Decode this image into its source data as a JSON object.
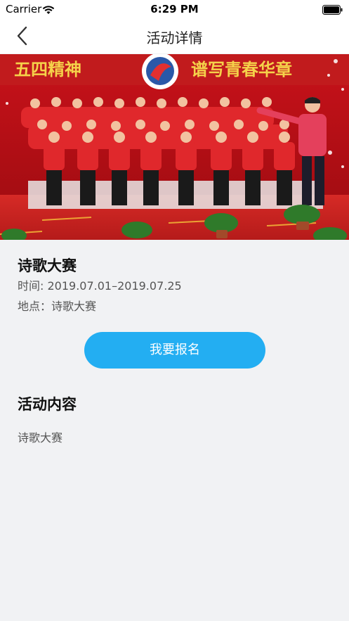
{
  "status_bar": {
    "carrier": "Carrier",
    "time": "6:29 PM"
  },
  "nav": {
    "title": "活动详情",
    "back_icon": "chevron-left-icon"
  },
  "banner": {
    "image": "choir-performance-photo",
    "banner_text_left": "五四精神",
    "banner_text_right": "谱写青春华章"
  },
  "activity": {
    "title": "诗歌大赛",
    "time": "时间: 2019.07.01–2019.07.25",
    "place": "地点：诗歌大赛"
  },
  "signup": {
    "label": "我要报名"
  },
  "content": {
    "heading": "活动内容",
    "body": "诗歌大赛"
  },
  "colors": {
    "accent": "#23aef2",
    "background": "#f1f2f4"
  }
}
